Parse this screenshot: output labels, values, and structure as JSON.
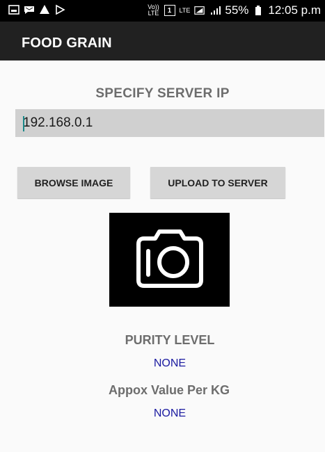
{
  "status_bar": {
    "left_icons": [
      "gallery-icon",
      "message-icon",
      "warning-icon",
      "play-icon"
    ],
    "volte": "Vo)) LTE",
    "sim": "1",
    "lte": "LTE",
    "battery": "55%",
    "time": "12:05 p.m"
  },
  "app": {
    "title": "FOOD GRAIN"
  },
  "server": {
    "label": "SPECIFY SERVER IP",
    "ip_value": "192.168.0.1"
  },
  "buttons": {
    "browse": "BROWSE IMAGE",
    "upload": "UPLOAD TO SERVER"
  },
  "image_preview": {
    "icon": "camera-icon"
  },
  "results": {
    "purity_label": "PURITY LEVEL",
    "purity_value": "NONE",
    "appox_label": "Appox Value Per KG",
    "appox_value": "NONE"
  },
  "colors": {
    "appbar": "#212121",
    "result_value": "#1a1aa0",
    "label_gray": "#6d6d6d",
    "button_bg": "#d6d6d6"
  }
}
